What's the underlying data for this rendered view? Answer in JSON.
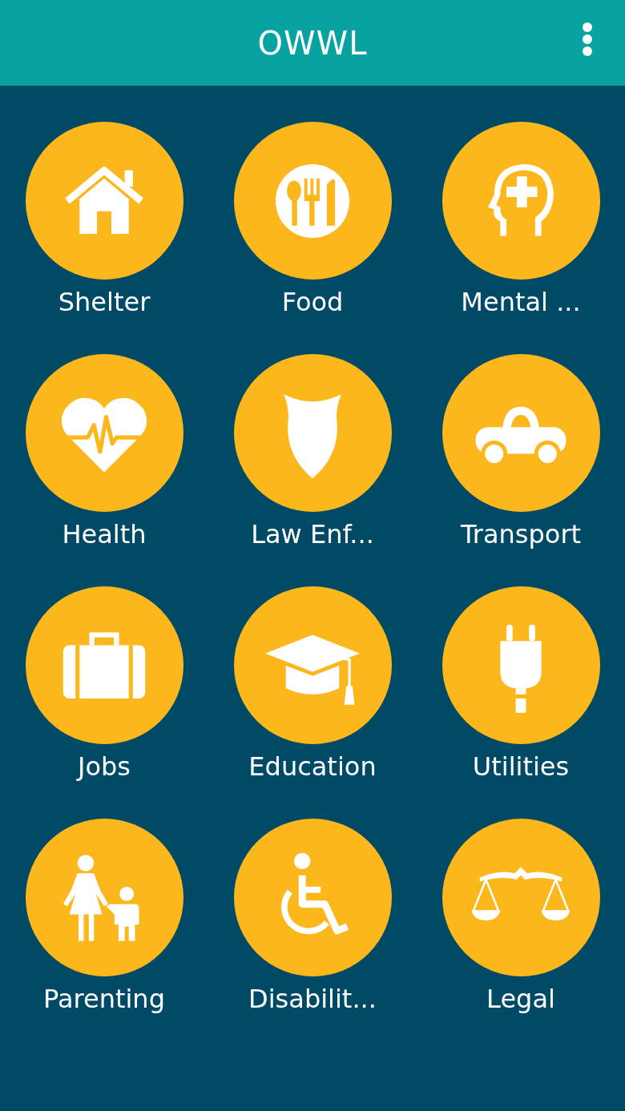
{
  "app_bar": {
    "title": "OWWL"
  },
  "categories": [
    {
      "label": "Shelter"
    },
    {
      "label": "Food"
    },
    {
      "label": "Mental ..."
    },
    {
      "label": "Health"
    },
    {
      "label": "Law Enf..."
    },
    {
      "label": "Transport"
    },
    {
      "label": "Jobs"
    },
    {
      "label": "Education"
    },
    {
      "label": "Utilities"
    },
    {
      "label": "Parenting"
    },
    {
      "label": "Disabilit..."
    },
    {
      "label": "Legal"
    }
  ]
}
